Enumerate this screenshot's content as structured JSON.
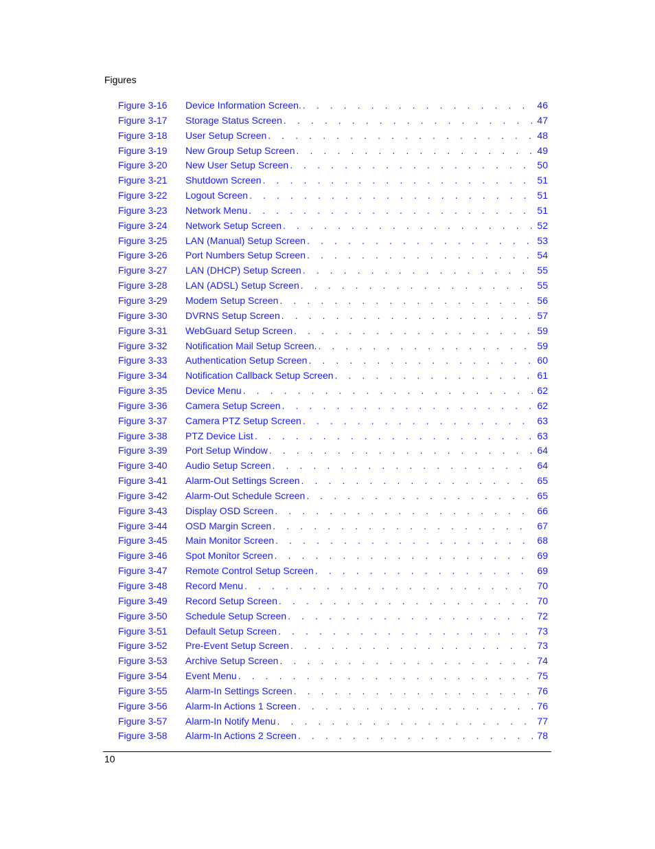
{
  "header": {
    "section_title": "Figures"
  },
  "entries": [
    {
      "figure": "Figure 3-16",
      "title": "Device Information Screen.",
      "page": "46"
    },
    {
      "figure": "Figure 3-17",
      "title": "Storage Status Screen",
      "page": "47"
    },
    {
      "figure": "Figure 3-18",
      "title": "User Setup Screen",
      "page": "48"
    },
    {
      "figure": "Figure 3-19",
      "title": "New Group Setup Screen",
      "page": "49"
    },
    {
      "figure": "Figure 3-20",
      "title": "New User Setup Screen",
      "page": "50"
    },
    {
      "figure": "Figure 3-21",
      "title": "Shutdown Screen",
      "page": "51"
    },
    {
      "figure": "Figure 3-22",
      "title": "Logout Screen",
      "page": "51"
    },
    {
      "figure": "Figure 3-23",
      "title": "Network Menu",
      "page": "51"
    },
    {
      "figure": "Figure 3-24",
      "title": "Network Setup Screen",
      "page": "52"
    },
    {
      "figure": "Figure 3-25",
      "title": "LAN (Manual) Setup Screen",
      "page": "53"
    },
    {
      "figure": "Figure 3-26",
      "title": "Port Numbers Setup Screen",
      "page": "54"
    },
    {
      "figure": "Figure 3-27",
      "title": "LAN (DHCP) Setup Screen",
      "page": "55"
    },
    {
      "figure": "Figure 3-28",
      "title": "LAN (ADSL) Setup Screen",
      "page": "55"
    },
    {
      "figure": "Figure 3-29",
      "title": "Modem Setup Screen",
      "page": "56"
    },
    {
      "figure": "Figure 3-30",
      "title": "DVRNS Setup Screen",
      "page": "57"
    },
    {
      "figure": "Figure 3-31",
      "title": "WebGuard Setup Screen",
      "page": "59"
    },
    {
      "figure": "Figure 3-32",
      "title": "Notification Mail Setup Screen.",
      "page": "59"
    },
    {
      "figure": "Figure 3-33",
      "title": "Authentication Setup Screen",
      "page": "60"
    },
    {
      "figure": "Figure 3-34",
      "title": "Notification Callback Setup Screen",
      "page": "61"
    },
    {
      "figure": "Figure 3-35",
      "title": "Device Menu",
      "page": "62"
    },
    {
      "figure": "Figure 3-36",
      "title": "Camera Setup Screen",
      "page": "62"
    },
    {
      "figure": "Figure 3-37",
      "title": "Camera PTZ Setup Screen",
      "page": "63"
    },
    {
      "figure": "Figure 3-38",
      "title": "PTZ Device List",
      "page": "63"
    },
    {
      "figure": "Figure 3-39",
      "title": "Port Setup Window",
      "page": "64"
    },
    {
      "figure": "Figure 3-40",
      "title": "Audio Setup Screen",
      "page": "64"
    },
    {
      "figure": "Figure 3-41",
      "title": "Alarm-Out Settings Screen",
      "page": "65"
    },
    {
      "figure": "Figure 3-42",
      "title": "Alarm-Out Schedule Screen",
      "page": "65"
    },
    {
      "figure": "Figure 3-43",
      "title": "Display OSD Screen",
      "page": "66"
    },
    {
      "figure": "Figure 3-44",
      "title": "OSD Margin Screen",
      "page": "67"
    },
    {
      "figure": "Figure 3-45",
      "title": "Main Monitor Screen",
      "page": "68"
    },
    {
      "figure": "Figure 3-46",
      "title": "Spot Monitor Screen",
      "page": "69"
    },
    {
      "figure": "Figure 3-47",
      "title": "Remote Control Setup Screen",
      "page": "69"
    },
    {
      "figure": "Figure 3-48",
      "title": "Record Menu",
      "page": "70"
    },
    {
      "figure": "Figure 3-49",
      "title": "Record Setup Screen",
      "page": "70"
    },
    {
      "figure": "Figure 3-50",
      "title": "Schedule Setup Screen",
      "page": "72"
    },
    {
      "figure": "Figure 3-51",
      "title": "Default Setup Screen",
      "page": "73"
    },
    {
      "figure": "Figure 3-52",
      "title": "Pre-Event Setup Screen",
      "page": "73"
    },
    {
      "figure": "Figure 3-53",
      "title": "Archive Setup Screen",
      "page": "74"
    },
    {
      "figure": "Figure 3-54",
      "title": "Event Menu",
      "page": "75"
    },
    {
      "figure": "Figure 3-55",
      "title": "Alarm-In Settings Screen",
      "page": "76"
    },
    {
      "figure": "Figure 3-56",
      "title": "Alarm-In Actions 1 Screen",
      "page": "76"
    },
    {
      "figure": "Figure 3-57",
      "title": "Alarm-In Notify Menu",
      "page": "77"
    },
    {
      "figure": "Figure 3-58",
      "title": "Alarm-In Actions 2 Screen",
      "page": "78"
    }
  ],
  "footer": {
    "page_number": "10"
  }
}
